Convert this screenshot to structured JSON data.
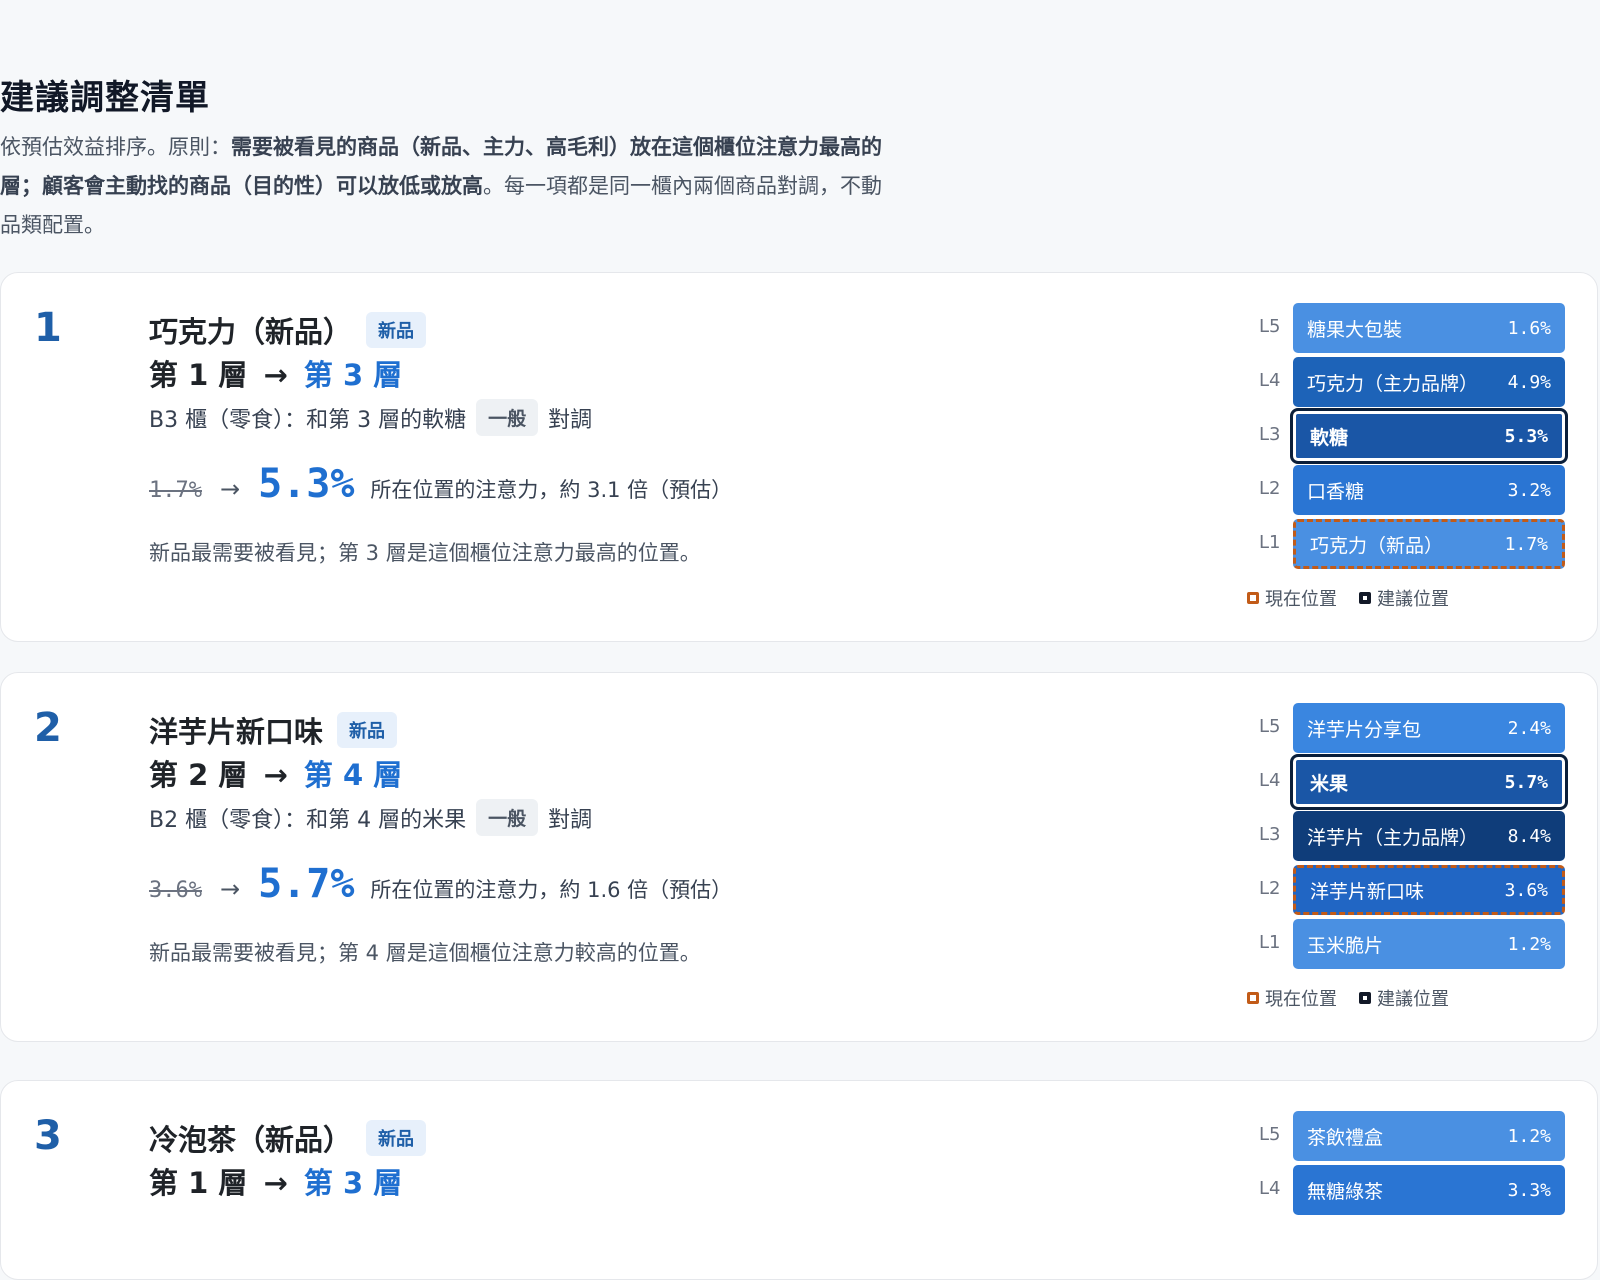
{
  "page": {
    "title": "建議調整清單",
    "intro_plain_1": "依預估效益排序。原則：",
    "intro_bold": "需要被看見的商品（新品、主力、高毛利）放在這個櫃位注意力最高的層；顧客會主動找的商品（目的性）可以放低或放高",
    "intro_plain_2": "。每一項都是同一櫃內兩個商品對調，不動品類配置。"
  },
  "legend": {
    "current": "現在位置",
    "suggested": "建議位置"
  },
  "cards": [
    {
      "rank": "1",
      "product": "巧克力（新品）",
      "badge": "新品",
      "move_from": "第 1 層",
      "arrow": "→",
      "move_to": "第 3 層",
      "swap_before": "B3 櫃（零食）：和第 3 層的軟糖",
      "swap_tag": "一般",
      "swap_after": "對調",
      "old_pct": "1.7%",
      "metric_arrow": "→",
      "new_pct": "5.3%",
      "metric_note": "所在位置的注意力，約 3.1 倍（預估）",
      "reason": "新品最需要被看見；第 3 層是這個櫃位注意力最高的位置。",
      "shelf": [
        {
          "level": "L5",
          "name": "糖果大包裝",
          "pct": "1.6%",
          "color": "#4a90e2",
          "state": "none"
        },
        {
          "level": "L4",
          "name": "巧克力（主力品牌）",
          "pct": "4.9%",
          "color": "#1d63b8",
          "state": "none"
        },
        {
          "level": "L3",
          "name": "軟糖",
          "pct": "5.3%",
          "color": "#1a56a6",
          "state": "suggested"
        },
        {
          "level": "L2",
          "name": "口香糖",
          "pct": "3.2%",
          "color": "#2a75d3",
          "state": "none"
        },
        {
          "level": "L1",
          "name": "巧克力（新品）",
          "pct": "1.7%",
          "color": "#4a90e2",
          "state": "current"
        }
      ]
    },
    {
      "rank": "2",
      "product": "洋芋片新口味",
      "badge": "新品",
      "move_from": "第 2 層",
      "arrow": "→",
      "move_to": "第 4 層",
      "swap_before": "B2 櫃（零食）：和第 4 層的米果",
      "swap_tag": "一般",
      "swap_after": "對調",
      "old_pct": "3.6%",
      "metric_arrow": "→",
      "new_pct": "5.7%",
      "metric_note": "所在位置的注意力，約 1.6 倍（預估）",
      "reason": "新品最需要被看見；第 4 層是這個櫃位注意力較高的位置。",
      "shelf": [
        {
          "level": "L5",
          "name": "洋芋片分享包",
          "pct": "2.4%",
          "color": "#3a86e0",
          "state": "none"
        },
        {
          "level": "L4",
          "name": "米果",
          "pct": "5.7%",
          "color": "#1a56a6",
          "state": "suggested"
        },
        {
          "level": "L3",
          "name": "洋芋片（主力品牌）",
          "pct": "8.4%",
          "color": "#0f3d7a",
          "state": "none"
        },
        {
          "level": "L2",
          "name": "洋芋片新口味",
          "pct": "3.6%",
          "color": "#2166c4",
          "state": "current"
        },
        {
          "level": "L1",
          "name": "玉米脆片",
          "pct": "1.2%",
          "color": "#4a90e2",
          "state": "none"
        }
      ]
    },
    {
      "rank": "3",
      "product": "冷泡茶（新品）",
      "badge": "新品",
      "move_from": "第 1 層",
      "arrow": "→",
      "move_to": "第 3 層",
      "shelf": [
        {
          "level": "L5",
          "name": "茶飲禮盒",
          "pct": "1.2%",
          "color": "#4a90e2",
          "state": "none"
        },
        {
          "level": "L4",
          "name": "無糖綠茶",
          "pct": "3.3%",
          "color": "#2a75d3",
          "state": "none"
        }
      ]
    }
  ]
}
